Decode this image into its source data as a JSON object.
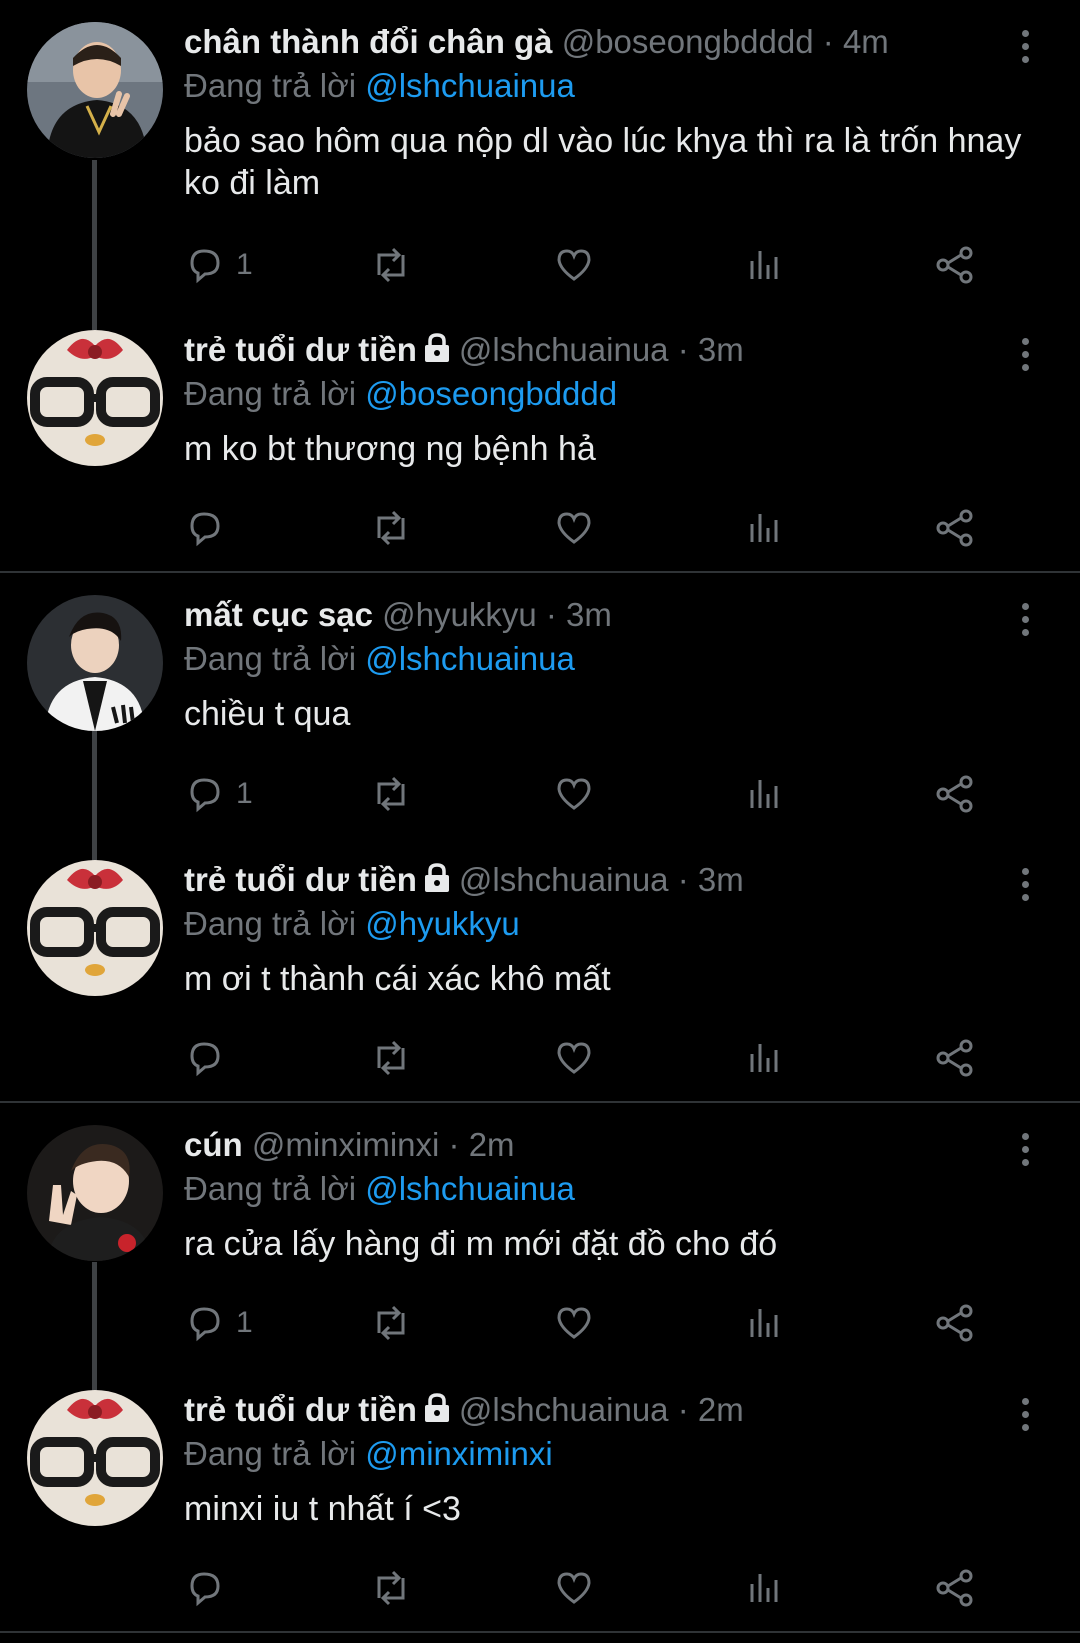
{
  "tweets": [
    {
      "name": "chân thành đổi chân gà",
      "handle": "@boseongbdddd",
      "dot": "·",
      "time": "4m",
      "reply_prefix": "Đang trả lời",
      "reply_to": "@lshchuainua",
      "text": "bảo sao hôm qua nộp dl vào lúc khya thì ra là trốn hnay ko đi làm",
      "reply_count": "1",
      "locked": false
    },
    {
      "name": "trẻ tuổi dư tiền",
      "handle": "@lshchuainua",
      "dot": "·",
      "time": "3m",
      "reply_prefix": "Đang trả lời",
      "reply_to": "@boseongbdddd",
      "text": "m ko bt thương ng bệnh hả",
      "reply_count": "",
      "locked": true
    },
    {
      "name": "mất cục sạc",
      "handle": "@hyukkyu",
      "dot": "·",
      "time": "3m",
      "reply_prefix": "Đang trả lời",
      "reply_to": "@lshchuainua",
      "text": "chiều t qua",
      "reply_count": "1",
      "locked": false
    },
    {
      "name": "trẻ tuổi dư tiền",
      "handle": "@lshchuainua",
      "dot": "·",
      "time": "3m",
      "reply_prefix": "Đang trả lời",
      "reply_to": "@hyukkyu",
      "text": "m ơi t thành cái xác khô mất",
      "reply_count": "",
      "locked": true
    },
    {
      "name": "cún",
      "handle": "@minximinxi",
      "dot": "·",
      "time": "2m",
      "reply_prefix": "Đang trả lời",
      "reply_to": "@lshchuainua",
      "text": "ra cửa lấy hàng đi m mới đặt đồ cho đó",
      "reply_count": "1",
      "locked": false
    },
    {
      "name": "trẻ tuổi dư tiền",
      "handle": "@lshchuainua",
      "dot": "·",
      "time": "2m",
      "reply_prefix": "Đang trả lời",
      "reply_to": "@minximinxi",
      "text": "minxi iu t nhất í <3",
      "reply_count": "",
      "locked": true
    }
  ],
  "icons": {
    "reply": "reply-icon",
    "retweet": "retweet-icon",
    "like": "heart-icon",
    "views": "views-chart-icon",
    "share": "share-icon",
    "more": "more-vertical-icon",
    "lock": "lock-icon"
  },
  "colors": {
    "background": "#000000",
    "text": "#e7e9ea",
    "muted": "#71767b",
    "mention": "#1d9bf0",
    "divider": "#2f3336"
  }
}
